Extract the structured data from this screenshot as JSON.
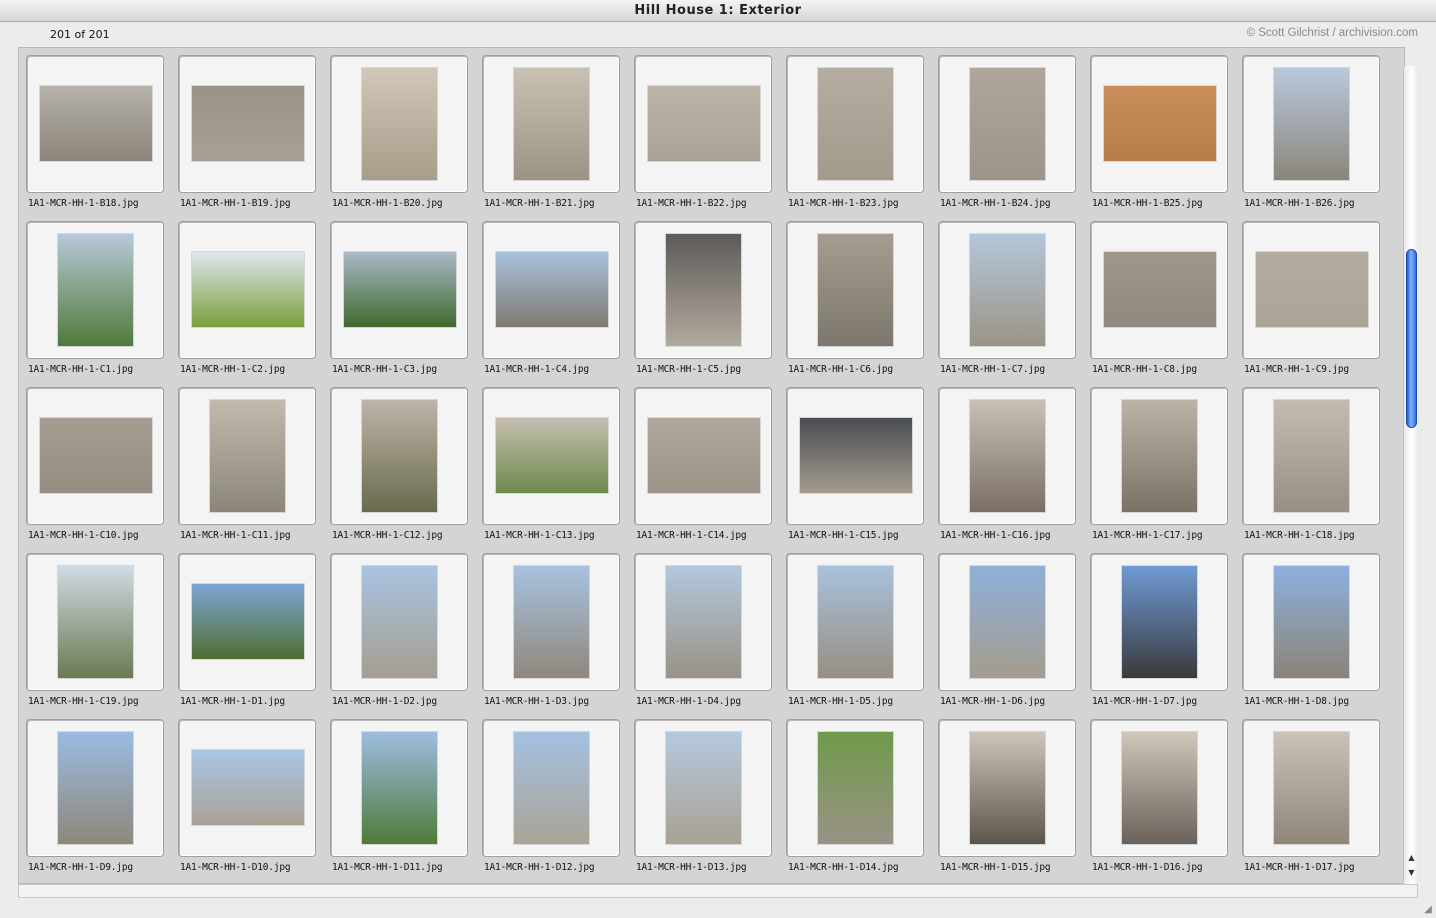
{
  "window": {
    "title": "Hill House 1: Exterior"
  },
  "status": {
    "count": "201 of 201"
  },
  "credit": "© Scott Gilchrist / archivision.com",
  "scroll": {
    "position_fraction": 0.26,
    "visible_fraction": 0.23
  },
  "thumbnails": [
    {
      "name": "1A1-MCR-HH-1-B18.jpg",
      "orient": "land",
      "top": "#b6b2aa",
      "bot": "#8c857a"
    },
    {
      "name": "1A1-MCR-HH-1-B19.jpg",
      "orient": "land",
      "top": "#9a9285",
      "bot": "#a8a094"
    },
    {
      "name": "1A1-MCR-HH-1-B20.jpg",
      "orient": "port",
      "top": "#d2c8b8",
      "bot": "#a89c8a"
    },
    {
      "name": "1A1-MCR-HH-1-B21.jpg",
      "orient": "port",
      "top": "#c9c1b3",
      "bot": "#9c9384"
    },
    {
      "name": "1A1-MCR-HH-1-B22.jpg",
      "orient": "land",
      "top": "#bdb5a8",
      "bot": "#aaa195"
    },
    {
      "name": "1A1-MCR-HH-1-B23.jpg",
      "orient": "port",
      "top": "#b5ada0",
      "bot": "#a39a8c"
    },
    {
      "name": "1A1-MCR-HH-1-B24.jpg",
      "orient": "port",
      "top": "#aea699",
      "bot": "#9d9588"
    },
    {
      "name": "1A1-MCR-HH-1-B25.jpg",
      "orient": "land",
      "top": "#c98f5a",
      "bot": "#b87c48"
    },
    {
      "name": "1A1-MCR-HH-1-B26.jpg",
      "orient": "port",
      "top": "#b8c9dc",
      "bot": "#8b857b"
    },
    {
      "name": "1A1-MCR-HH-1-C1.jpg",
      "orient": "port",
      "top": "#b9c8d8",
      "bot": "#4f7a3a"
    },
    {
      "name": "1A1-MCR-HH-1-C2.jpg",
      "orient": "land",
      "top": "#dfe6ee",
      "bot": "#7aa03a"
    },
    {
      "name": "1A1-MCR-HH-1-C3.jpg",
      "orient": "land",
      "top": "#aab8c8",
      "bot": "#3f6a2e"
    },
    {
      "name": "1A1-MCR-HH-1-C4.jpg",
      "orient": "land",
      "top": "#a9c2dc",
      "bot": "#7f7a70"
    },
    {
      "name": "1A1-MCR-HH-1-C5.jpg",
      "orient": "port",
      "top": "#5d5a58",
      "bot": "#b2aa9e"
    },
    {
      "name": "1A1-MCR-HH-1-C6.jpg",
      "orient": "port",
      "top": "#a59d90",
      "bot": "#7c766c"
    },
    {
      "name": "1A1-MCR-HH-1-C7.jpg",
      "orient": "port",
      "top": "#b5c7d9",
      "bot": "#9b9387"
    },
    {
      "name": "1A1-MCR-HH-1-C8.jpg",
      "orient": "land",
      "top": "#9f978a",
      "bot": "#8f887c"
    },
    {
      "name": "1A1-MCR-HH-1-C9.jpg",
      "orient": "land",
      "top": "#b3ab9e",
      "bot": "#aca497"
    },
    {
      "name": "1A1-MCR-HH-1-C10.jpg",
      "orient": "land",
      "top": "#a59d90",
      "bot": "#958d80"
    },
    {
      "name": "1A1-MCR-HH-1-C11.jpg",
      "orient": "port",
      "top": "#c2baad",
      "bot": "#8c857a"
    },
    {
      "name": "1A1-MCR-HH-1-C12.jpg",
      "orient": "port",
      "top": "#bdb5a8",
      "bot": "#6a6a4e"
    },
    {
      "name": "1A1-MCR-HH-1-C13.jpg",
      "orient": "land",
      "top": "#c6beb1",
      "bot": "#6f8a4a"
    },
    {
      "name": "1A1-MCR-HH-1-C14.jpg",
      "orient": "land",
      "top": "#b0a89b",
      "bot": "#9b9487"
    },
    {
      "name": "1A1-MCR-HH-1-C15.jpg",
      "orient": "land",
      "top": "#4a4d52",
      "bot": "#a39b8e"
    },
    {
      "name": "1A1-MCR-HH-1-C16.jpg",
      "orient": "port",
      "top": "#c9c1b4",
      "bot": "#7a6f64"
    },
    {
      "name": "1A1-MCR-HH-1-C17.jpg",
      "orient": "port",
      "top": "#bcb4a7",
      "bot": "#7b7266"
    },
    {
      "name": "1A1-MCR-HH-1-C18.jpg",
      "orient": "port",
      "top": "#c4bcaf",
      "bot": "#978f82"
    },
    {
      "name": "1A1-MCR-HH-1-C19.jpg",
      "orient": "port",
      "top": "#d0dae4",
      "bot": "#6b7a52"
    },
    {
      "name": "1A1-MCR-HH-1-D1.jpg",
      "orient": "land",
      "top": "#7ea6d4",
      "bot": "#4f6e30"
    },
    {
      "name": "1A1-MCR-HH-1-D2.jpg",
      "orient": "port",
      "top": "#a9c4e2",
      "bot": "#a59d90"
    },
    {
      "name": "1A1-MCR-HH-1-D3.jpg",
      "orient": "port",
      "top": "#a7c2df",
      "bot": "#8f887c"
    },
    {
      "name": "1A1-MCR-HH-1-D4.jpg",
      "orient": "port",
      "top": "#b2c7dd",
      "bot": "#9a9286"
    },
    {
      "name": "1A1-MCR-HH-1-D5.jpg",
      "orient": "port",
      "top": "#a9c1dc",
      "bot": "#978f83"
    },
    {
      "name": "1A1-MCR-HH-1-D6.jpg",
      "orient": "port",
      "top": "#8fb0d8",
      "bot": "#a49c8f"
    },
    {
      "name": "1A1-MCR-HH-1-D7.jpg",
      "orient": "port",
      "top": "#6f9ad4",
      "bot": "#3a3a3c"
    },
    {
      "name": "1A1-MCR-HH-1-D8.jpg",
      "orient": "port",
      "top": "#8db1de",
      "bot": "#8b8378"
    },
    {
      "name": "1A1-MCR-HH-1-D9.jpg",
      "orient": "port",
      "top": "#9bbbe2",
      "bot": "#8e877b"
    },
    {
      "name": "1A1-MCR-HH-1-D10.jpg",
      "orient": "land",
      "top": "#a8c6e6",
      "bot": "#aaa296"
    },
    {
      "name": "1A1-MCR-HH-1-D11.jpg",
      "orient": "port",
      "top": "#9fbde0",
      "bot": "#4f7a3a"
    },
    {
      "name": "1A1-MCR-HH-1-D12.jpg",
      "orient": "port",
      "top": "#a4c1e2",
      "bot": "#aba396"
    },
    {
      "name": "1A1-MCR-HH-1-D13.jpg",
      "orient": "port",
      "top": "#b4c9df",
      "bot": "#a9a194"
    },
    {
      "name": "1A1-MCR-HH-1-D14.jpg",
      "orient": "port",
      "top": "#6f9a4a",
      "bot": "#9a9286"
    },
    {
      "name": "1A1-MCR-HH-1-D15.jpg",
      "orient": "port",
      "top": "#cdc5b8",
      "bot": "#5d564d"
    },
    {
      "name": "1A1-MCR-HH-1-D16.jpg",
      "orient": "port",
      "top": "#cfc7ba",
      "bot": "#6a625a"
    },
    {
      "name": "1A1-MCR-HH-1-D17.jpg",
      "orient": "port",
      "top": "#cbc3b6",
      "bot": "#8e8679"
    }
  ]
}
